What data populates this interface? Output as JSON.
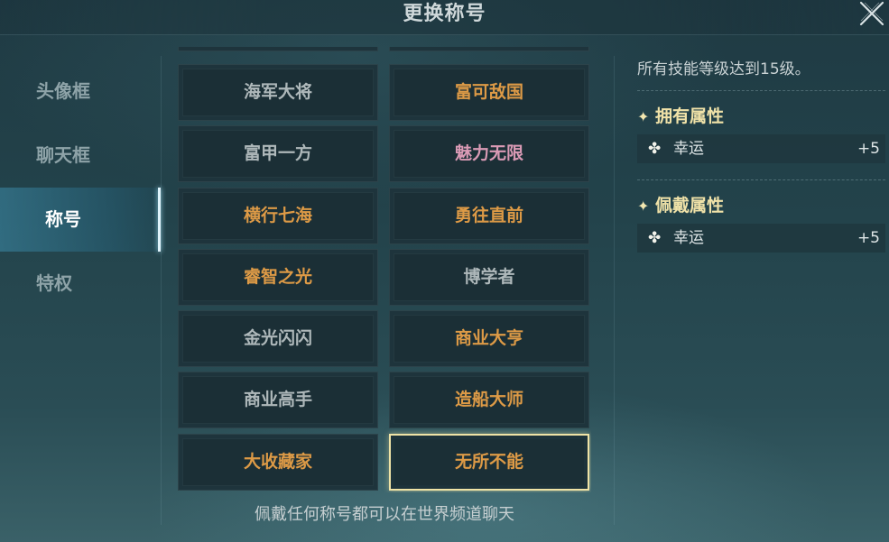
{
  "header": {
    "title": "更换称号"
  },
  "sidebar": {
    "items": [
      {
        "label": "头像框"
      },
      {
        "label": "聊天框"
      },
      {
        "label": "称号"
      },
      {
        "label": "特权"
      }
    ]
  },
  "titles": [
    {
      "label": "海军大将",
      "color": "gray"
    },
    {
      "label": "富可敌国",
      "color": "orange"
    },
    {
      "label": "富甲一方",
      "color": "gray"
    },
    {
      "label": "魅力无限",
      "color": "pink"
    },
    {
      "label": "横行七海",
      "color": "orange"
    },
    {
      "label": "勇往直前",
      "color": "orange"
    },
    {
      "label": "睿智之光",
      "color": "orange"
    },
    {
      "label": "博学者",
      "color": "gray"
    },
    {
      "label": "金光闪闪",
      "color": "gray"
    },
    {
      "label": "商业大亨",
      "color": "orange"
    },
    {
      "label": "商业高手",
      "color": "gray"
    },
    {
      "label": "造船大师",
      "color": "orange"
    },
    {
      "label": "大收藏家",
      "color": "orange"
    },
    {
      "label": "无所不能",
      "color": "orange",
      "selected": true
    }
  ],
  "footer": {
    "note": "佩戴任何称号都可以在世界频道聊天"
  },
  "detail": {
    "requirement": "所有技能等级达到15级。",
    "owned": {
      "heading": "拥有属性",
      "attr_name": "幸运",
      "attr_value": "+5"
    },
    "worn": {
      "heading": "佩戴属性",
      "attr_name": "幸运",
      "attr_value": "+5"
    }
  },
  "colors": {
    "gray": "#aeb8ba",
    "orange": "#dd9a46",
    "pink": "#d99ab5",
    "gold_heading": "#f0e2a8",
    "selected_border": "#efe3a6"
  },
  "icons": {
    "close": "close-x-icon",
    "star": "sparkle-star-icon",
    "clover": "clover-icon"
  }
}
